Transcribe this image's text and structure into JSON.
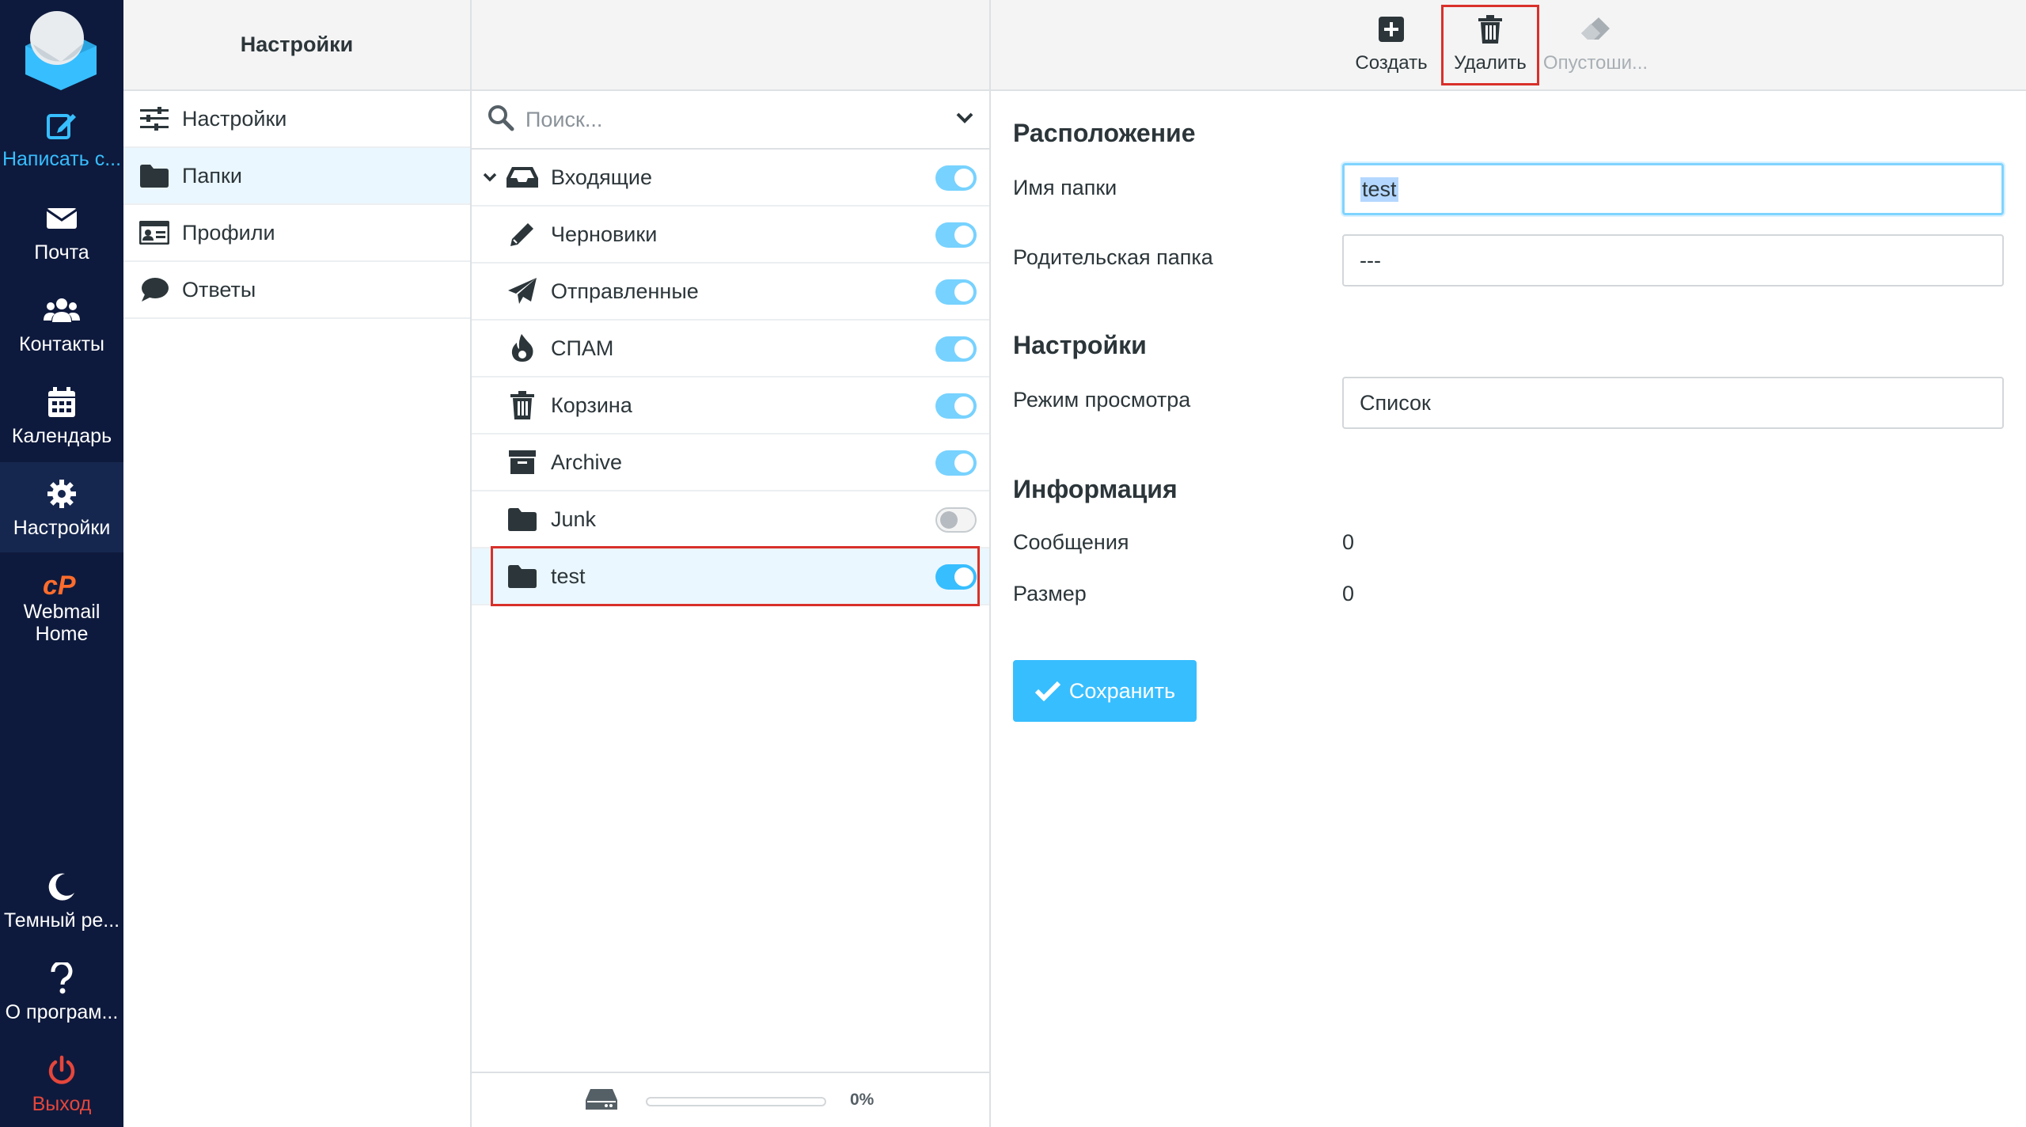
{
  "nav": {
    "compose": "Написать с...",
    "mail": "Почта",
    "contacts": "Контакты",
    "calendar": "Календарь",
    "settings": "Настройки",
    "cpanel_line1": "Webmail",
    "cpanel_line2": "Home",
    "dark_mode": "Темный ре...",
    "about": "О програм...",
    "logout": "Выход"
  },
  "settings_menu": {
    "header": "Настройки",
    "items": [
      {
        "label": "Настройки",
        "icon": "sliders-icon"
      },
      {
        "label": "Папки",
        "icon": "folder-icon",
        "selected": true
      },
      {
        "label": "Профили",
        "icon": "id-card-icon"
      },
      {
        "label": "Ответы",
        "icon": "comment-icon"
      }
    ]
  },
  "folders": {
    "search_placeholder": "Поиск...",
    "items": [
      {
        "label": "Входящие",
        "icon": "inbox-icon",
        "subscribed": true
      },
      {
        "label": "Черновики",
        "icon": "pencil-icon",
        "subscribed": true
      },
      {
        "label": "Отправленные",
        "icon": "paper-plane-icon",
        "subscribed": true
      },
      {
        "label": "СПАМ",
        "icon": "fire-icon",
        "subscribed": true
      },
      {
        "label": "Корзина",
        "icon": "trash-icon",
        "subscribed": true
      },
      {
        "label": "Archive",
        "icon": "archive-icon",
        "subscribed": true
      },
      {
        "label": "Junk",
        "icon": "folder-icon",
        "subscribed": false
      },
      {
        "label": "test",
        "icon": "folder-icon",
        "subscribed": true,
        "selected": true
      }
    ],
    "quota_percent": "0%"
  },
  "toolbar": {
    "create": "Создать",
    "delete": "Удалить",
    "empty": "Опустоши..."
  },
  "detail": {
    "location_title": "Расположение",
    "folder_name_label": "Имя папки",
    "folder_name_value": "test",
    "parent_label": "Родительская папка",
    "parent_value": "---",
    "settings_title": "Настройки",
    "view_mode_label": "Режим просмотра",
    "view_mode_value": "Список",
    "info_title": "Информация",
    "messages_label": "Сообщения",
    "messages_value": "0",
    "size_label": "Размер",
    "size_value": "0",
    "save_label": "Сохранить"
  },
  "colors": {
    "nav_bg": "#0e1a3d",
    "accent": "#37beff",
    "highlight_frame": "#d9302a",
    "logout": "#e5463b",
    "cpanel": "#ff6c2c"
  }
}
